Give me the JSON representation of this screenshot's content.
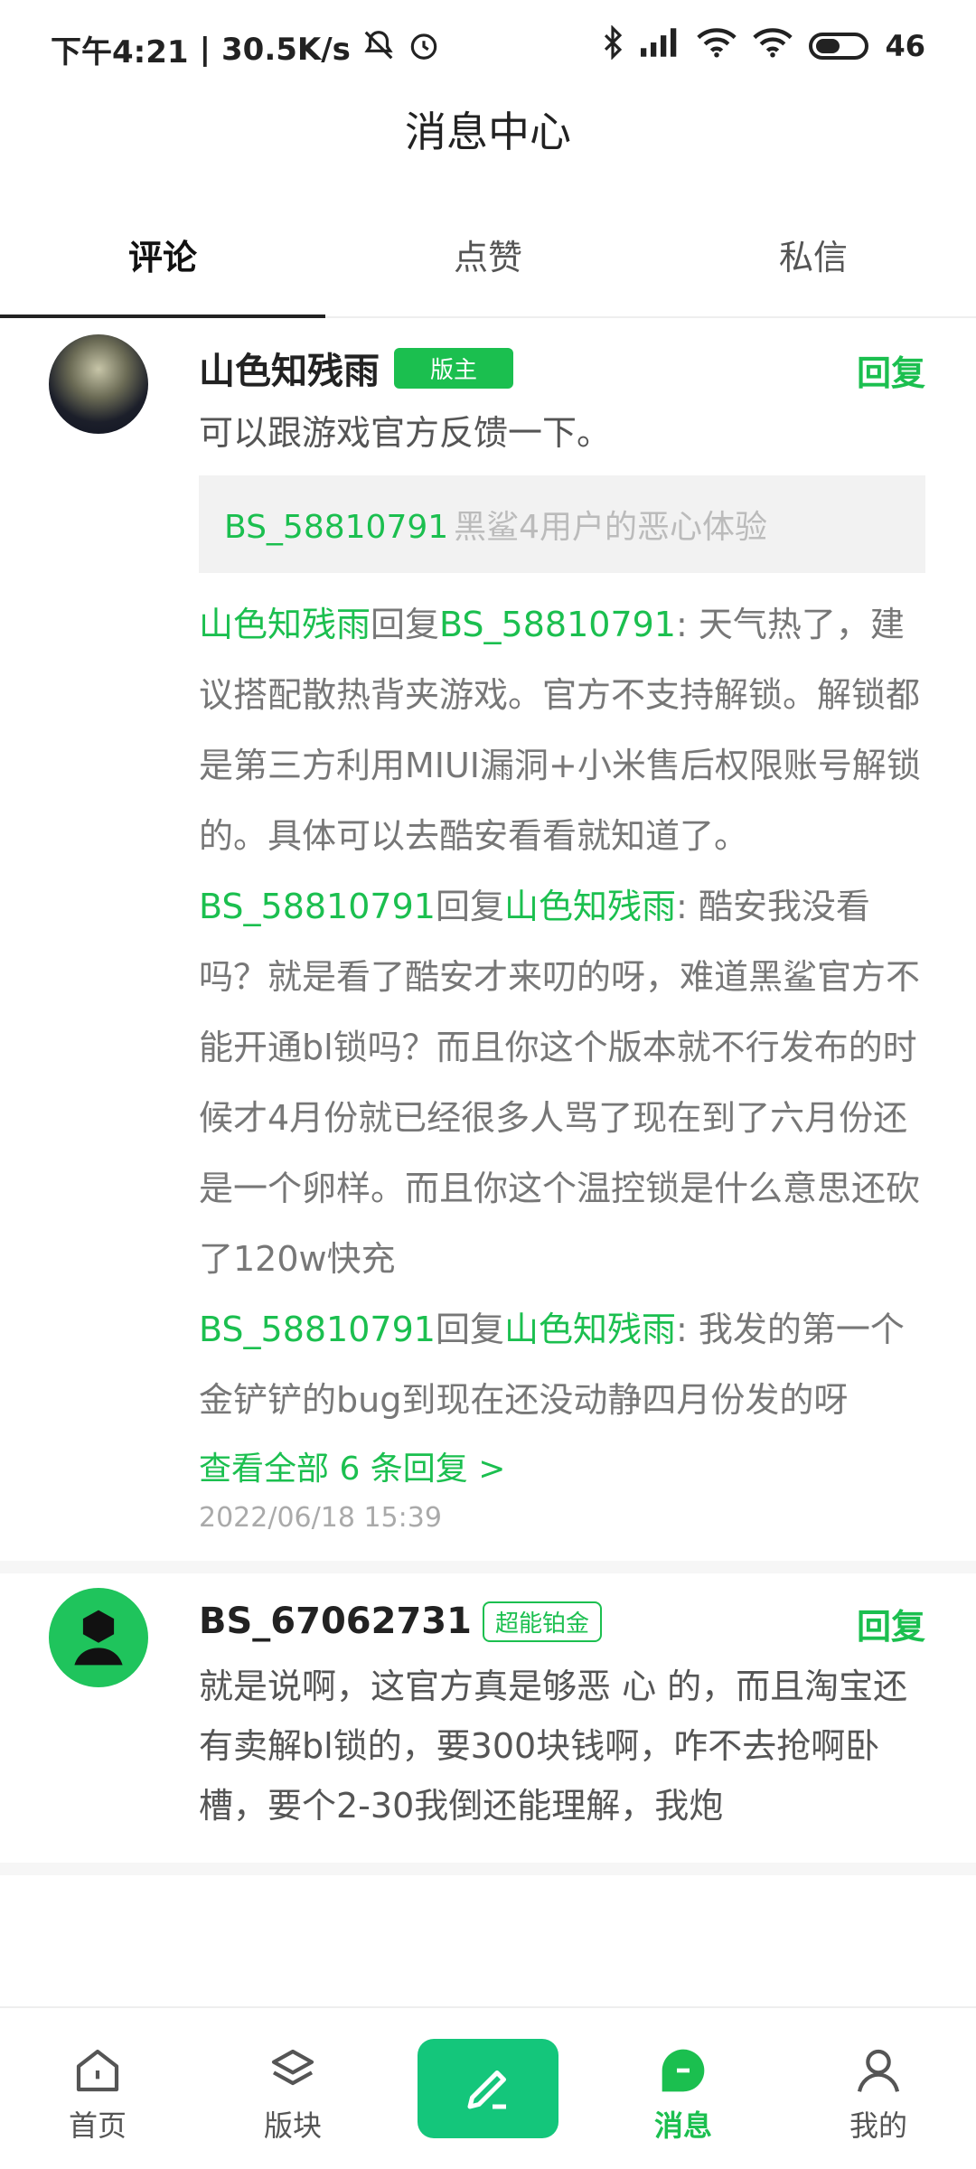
{
  "status": {
    "time": "下午4:21",
    "net_speed": "30.5K/s",
    "battery": "46"
  },
  "header": {
    "title": "消息中心"
  },
  "tabs": [
    {
      "label": "评论"
    },
    {
      "label": "点赞"
    },
    {
      "label": "私信"
    }
  ],
  "comments": [
    {
      "user": "山色知残雨",
      "badge": "版主",
      "reply_label": "回复",
      "content": "可以跟游戏官方反馈一下。",
      "quote_user": "BS_58810791",
      "quote_text": "黑鲨4用户的恶心体验",
      "replies": [
        {
          "from": "山色知残雨",
          "word": "回复",
          "to": "BS_58810791",
          "sep": ": ",
          "text": "天气热了，建议搭配散热背夹游戏。官方不支持解锁。解锁都是第三方利用MIUI漏洞+小米售后权限账号解锁的。具体可以去酷安看看就知道了。"
        },
        {
          "from": "BS_58810791",
          "word": "回复",
          "to": "山色知残雨",
          "sep": ": ",
          "text": "酷安我没看吗？就是看了酷安才来叨的呀，难道黑鲨官方不能开通bl锁吗？而且你这个版本就不行发布的时候才4月份就已经很多人骂了现在到了六月份还是一个卵样。而且你这个温控锁是什么意思还砍了120w快充"
        },
        {
          "from": "BS_58810791",
          "word": "回复",
          "to": "山色知残雨",
          "sep": ": ",
          "text": "我发的第一个金铲铲的bug到现在还没动静四月份发的呀"
        }
      ],
      "view_all": "查看全部 6 条回复 >",
      "date": "2022/06/18 15:39"
    },
    {
      "user": "BS_67062731",
      "badge": "超能铂金",
      "reply_label": "回复",
      "content": "就是说啊，这官方真是够恶 心 的，而且淘宝还有卖解bl锁的，要300块钱啊，咋不去抢啊卧槽，要个2-30我倒还能理解，我炮"
    }
  ],
  "bottom_nav": [
    {
      "label": "首页"
    },
    {
      "label": "版块"
    },
    {
      "label": ""
    },
    {
      "label": "消息"
    },
    {
      "label": "我的"
    }
  ],
  "colors": {
    "accent": "#1bbf4f",
    "post_button": "#14c67b"
  }
}
